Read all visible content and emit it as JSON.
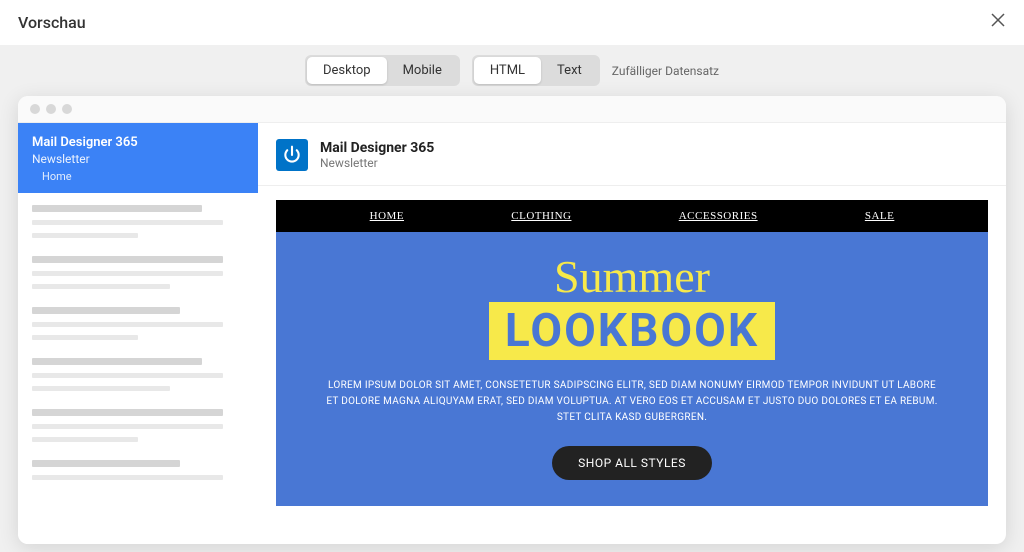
{
  "header": {
    "title": "Vorschau"
  },
  "toolbar": {
    "device": {
      "desktop": "Desktop",
      "mobile": "Mobile"
    },
    "format": {
      "html": "HTML",
      "text": "Text"
    },
    "random": "Zufälliger Datensatz"
  },
  "sidebar": {
    "title": "Mail Designer 365",
    "subtitle": "Newsletter",
    "home": "Home"
  },
  "content": {
    "title": "Mail Designer 365",
    "subtitle": "Newsletter"
  },
  "email": {
    "nav": {
      "home": "HOME",
      "clothing": "CLOTHING",
      "accessories": "ACCESSORIES",
      "sale": "SALE"
    },
    "hero": {
      "summer": "Summer",
      "lookbook": "LOOKBOOK",
      "paragraph": "LOREM IPSUM DOLOR SIT AMET, CONSETETUR SADIPSCING ELITR, SED DIAM NONUMY EIRMOD TEMPOR INVIDUNT UT LABORE ET DOLORE MAGNA ALIQUYAM ERAT, SED DIAM VOLUPTUA. AT VERO EOS ET ACCUSAM ET JUSTO DUO DOLORES ET EA REBUM. STET CLITA KASD GUBERGREN.",
      "cta": "SHOP ALL STYLES"
    }
  }
}
